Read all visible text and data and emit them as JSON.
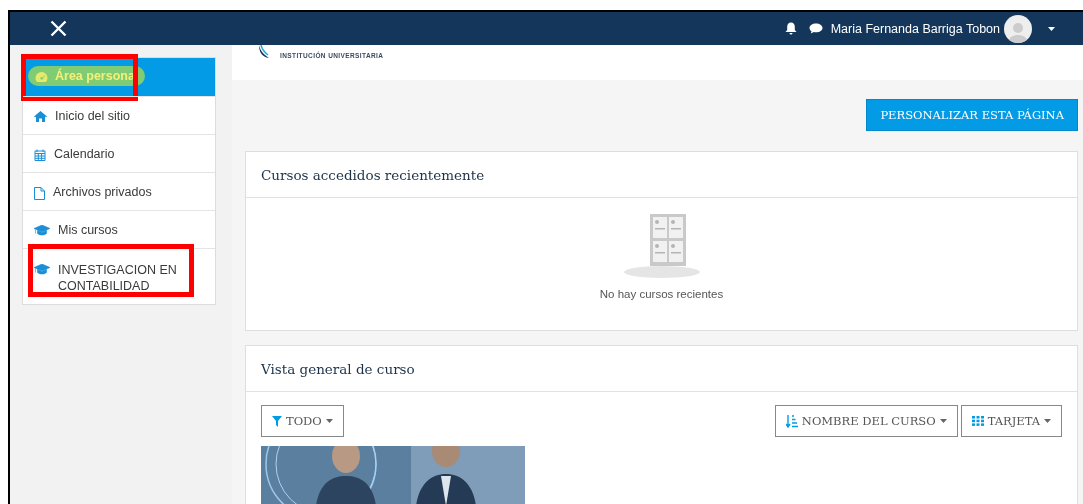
{
  "navbar": {
    "user_name": "Maria Fernanda Barriga Tobon"
  },
  "logo": {
    "subtitle": "INSTITUCIÓN UNIVERSITARIA"
  },
  "sidebar": {
    "items": [
      {
        "label": "Área persona",
        "kind": "dashboard",
        "selected": true,
        "annotated": true
      },
      {
        "label": "Inicio del sitio",
        "kind": "home",
        "selected": false,
        "annotated": false
      },
      {
        "label": "Calendario",
        "kind": "calendar",
        "selected": false,
        "annotated": false
      },
      {
        "label": "Archivos privados",
        "kind": "file",
        "selected": false,
        "annotated": false
      },
      {
        "label": "Mis cursos",
        "kind": "course",
        "selected": false,
        "annotated": false
      },
      {
        "label": "INVESTIGACION EN CONTABILIDAD",
        "kind": "course",
        "selected": false,
        "annotated": true
      }
    ]
  },
  "customize_button": "PERSONALIZAR ESTA PÁGINA",
  "recent": {
    "title": "Cursos accedidos recientemente",
    "empty_text": "No hay cursos recientes"
  },
  "overview": {
    "title": "Vista general de curso",
    "filter": "TODO",
    "sort": "NOMBRE DEL CURSO",
    "view": "TARJETA"
  }
}
